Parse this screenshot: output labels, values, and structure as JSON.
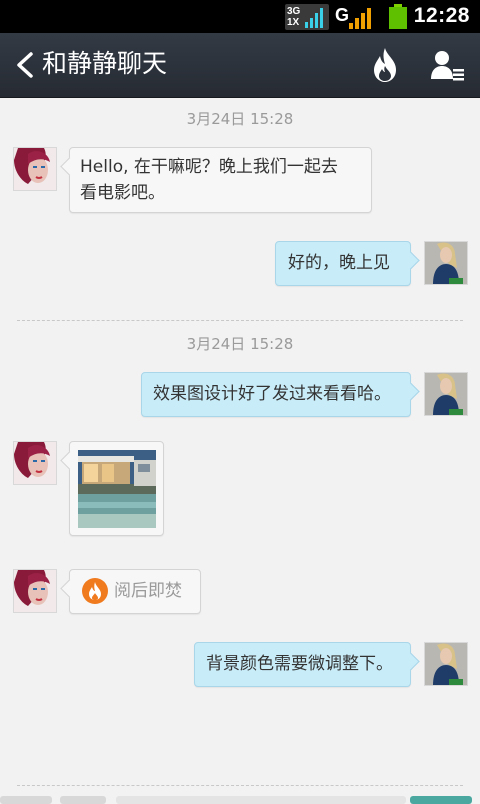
{
  "status_bar": {
    "network_line1": "3G",
    "network_line2": "1X",
    "carrier_letter": "G",
    "time": "12:28"
  },
  "header": {
    "title": "和静静聊天",
    "icons": [
      "back-icon",
      "fire-icon",
      "profile-icon"
    ]
  },
  "chat": {
    "timestamps": [
      "3月24日   15:28",
      "3月24日   15:28"
    ],
    "messages": [
      {
        "side": "left",
        "type": "text",
        "text_line1": "Hello, 在干嘛呢？晚上我们一起去",
        "text_line2": "看电影吧。"
      },
      {
        "side": "right",
        "type": "text",
        "text": "好的，晚上见"
      },
      {
        "side": "right",
        "type": "text",
        "text": "效果图设计好了发过来看看哈。"
      },
      {
        "side": "left",
        "type": "image"
      },
      {
        "side": "left",
        "type": "burn",
        "text": "阅后即焚"
      },
      {
        "side": "right",
        "type": "text",
        "text": "背景颜色需要微调整下。"
      }
    ]
  },
  "colors": {
    "title_bar": "#2c323b",
    "bubble_sent": "#c8ecf8",
    "bubble_received": "#f7f7f7",
    "burn_accent": "#f07a1e"
  }
}
